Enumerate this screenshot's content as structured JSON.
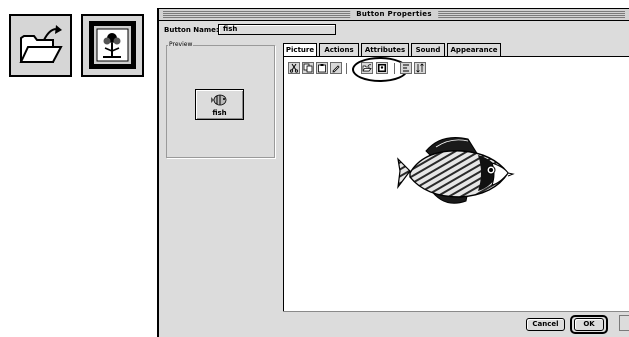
{
  "zoomed_icons": {
    "left": "open-file-icon",
    "right": "picture-frame-icon"
  },
  "dialog": {
    "title": "Button Properties",
    "button_name_label": "Button Name:",
    "button_name_value": "fish",
    "preview_label": "Preview",
    "preview_button_label": "fish"
  },
  "tabs": [
    {
      "label": "Picture",
      "active": true
    },
    {
      "label": "Actions",
      "active": false
    },
    {
      "label": "Attributes",
      "active": false
    },
    {
      "label": "Sound",
      "active": false
    },
    {
      "label": "Appearance",
      "active": false
    }
  ],
  "toolbar": {
    "buttons": [
      "cut-icon",
      "copy-icon",
      "paste-icon",
      "pencil-icon",
      "open-file-icon",
      "picture-frame-icon",
      "align-icon",
      "sort-icon"
    ],
    "highlighted": [
      "open-file-icon",
      "picture-frame-icon"
    ]
  },
  "footer": {
    "cancel_label": "Cancel",
    "ok_label": "OK"
  }
}
